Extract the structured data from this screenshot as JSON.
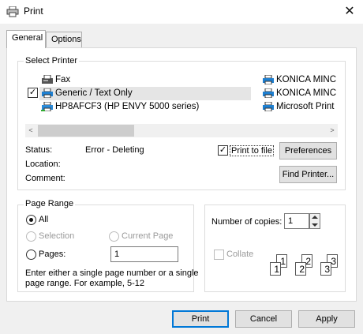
{
  "window": {
    "title": "Print",
    "close_glyph": "✕"
  },
  "tabs": [
    {
      "label": "General"
    },
    {
      "label": "Options"
    }
  ],
  "select_printer": {
    "title": "Select Printer",
    "printers_left": [
      {
        "name": "Fax",
        "icon": "fax-icon"
      },
      {
        "name": "Generic / Text Only",
        "icon": "printer-icon",
        "selected": true,
        "default": true
      },
      {
        "name": "HP8AFCF3 (HP ENVY 5000 series)",
        "icon": "network-printer-icon"
      }
    ],
    "printers_right": [
      {
        "name": "KONICA MINC"
      },
      {
        "name": "KONICA MINC"
      },
      {
        "name": "Microsoft Print"
      }
    ],
    "scroll": {
      "left_arrow": "<",
      "right_arrow": ">"
    },
    "status_label": "Status:",
    "status_value": "Error - Deleting",
    "location_label": "Location:",
    "comment_label": "Comment:",
    "print_to_file_label": "Print to file",
    "print_to_file_checked": true,
    "preferences_button": "Preferences",
    "find_printer_button": "Find Printer..."
  },
  "page_range": {
    "title": "Page Range",
    "all_label": "All",
    "selection_label": "Selection",
    "current_page_label": "Current Page",
    "pages_label": "Pages:",
    "pages_value": "1",
    "help_text_line1": "Enter either a single page number or a single",
    "help_text_line2": "page range.  For example, 5-12"
  },
  "copies": {
    "number_label": "Number of copies:",
    "number_value": "1",
    "collate_label": "Collate"
  },
  "buttons": {
    "print": "Print",
    "cancel": "Cancel",
    "apply": "Apply"
  }
}
